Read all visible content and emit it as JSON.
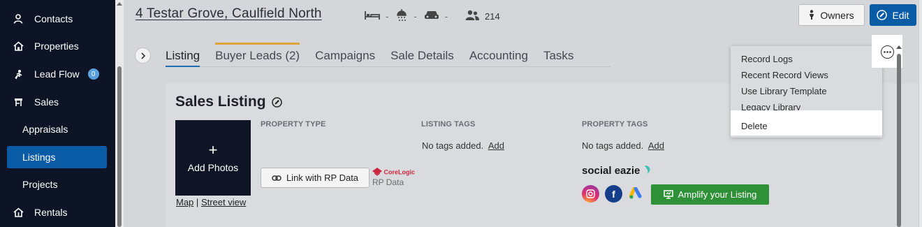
{
  "sidebar": {
    "items": [
      {
        "label": "Contacts",
        "icon": "person-icon"
      },
      {
        "label": "Properties",
        "icon": "home-icon"
      },
      {
        "label": "Lead Flow",
        "icon": "lead-flow-icon",
        "badge": "0"
      },
      {
        "label": "Sales",
        "icon": "sales-icon"
      },
      {
        "label": "Appraisals"
      },
      {
        "label": "Listings"
      },
      {
        "label": "Projects"
      },
      {
        "label": "Rentals",
        "icon": "rentals-icon"
      }
    ],
    "active": "Listings"
  },
  "header": {
    "title": "4 Testar Grove, Caulfield North",
    "beds": "-",
    "baths": "-",
    "cars": "-",
    "contacts_count": "214",
    "owners_label": "Owners",
    "edit_label": "Edit"
  },
  "tabs": [
    {
      "label": "Listing",
      "active": true
    },
    {
      "label": "Buyer Leads (2)"
    },
    {
      "label": "Campaigns"
    },
    {
      "label": "Sale Details"
    },
    {
      "label": "Accounting"
    },
    {
      "label": "Tasks"
    }
  ],
  "listing": {
    "title": "Sales Listing",
    "add_photos": "Add Photos",
    "map_link": "Map",
    "separator": "|",
    "street_view_link": "Street view",
    "property_type_header": "PROPERTY TYPE",
    "listing_tags_header": "LISTING TAGS",
    "property_tags_header": "PROPERTY TAGS",
    "no_tags_text": "No tags added.",
    "add_label": "Add",
    "rp_button": "Link with RP Data",
    "corelogic_brand": "CoreLogic",
    "rp_data_text": "RP Data",
    "social_brand": "social eazie",
    "amplify_button": "Amplify your Listing"
  },
  "dropdown": {
    "items": [
      "Record Logs",
      "Recent Record Views",
      "Use Library Template",
      "Legacy Library",
      "Delete"
    ],
    "highlighted": "Delete"
  },
  "colors": {
    "sidebar_bg": "#0c1426",
    "accent": "#0a5ba6",
    "amplify": "#2f9137",
    "tab_hover": "#e0a43c"
  }
}
